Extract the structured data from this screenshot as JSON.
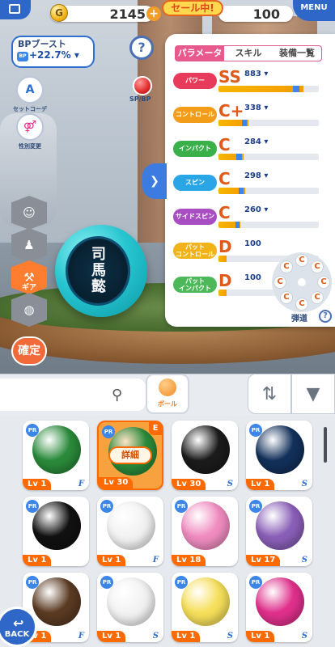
{
  "topbar": {
    "coins": "2145",
    "coin_glyph": "G",
    "plus": "+",
    "sale": "セール中!",
    "gems": "100",
    "menu_label": "MENU"
  },
  "boost": {
    "label": "BPブースト",
    "value": "+22.7% ▾",
    "chip": "BP"
  },
  "side": {
    "set_coordinate": "セットコーデ",
    "gender_change": "性別変更",
    "spbp": "SP/BP",
    "help": "?"
  },
  "vtabs": {
    "gear_label": "ギア"
  },
  "confirm_label": "確定",
  "panel": {
    "tabs": [
      "パラメータ",
      "スキル",
      "装備一覧"
    ],
    "active_tab": 0,
    "stats": [
      {
        "name": "パワー",
        "rank": "SS",
        "value": "883 ▾",
        "fill": 0.85,
        "blue_start": 0.74,
        "blue_width": 0.07,
        "color": "#e83a5a"
      },
      {
        "name": "コントロール",
        "rank": "C+",
        "value": "338 ▾",
        "fill": 0.3,
        "blue_start": 0.23,
        "blue_width": 0.05,
        "color": "#f29c1a"
      },
      {
        "name": "インパクト",
        "rank": "C",
        "value": "284 ▾",
        "fill": 0.25,
        "blue_start": 0.18,
        "blue_width": 0.05,
        "color": "#39b04a"
      },
      {
        "name": "スピン",
        "rank": "C",
        "value": "298 ▾",
        "fill": 0.27,
        "blue_start": 0.2,
        "blue_width": 0.05,
        "color": "#2aa6e6"
      },
      {
        "name": "サイドスピン",
        "rank": "C",
        "value": "260 ▾",
        "fill": 0.22,
        "blue_start": 0.17,
        "blue_width": 0.04,
        "color": "#a84ec2"
      },
      {
        "name": "パット\nコントロール",
        "rank": "D",
        "value": "100",
        "fill": 0.08,
        "blue_start": 0.05,
        "blue_width": 0.0,
        "color": "#f2b21a"
      },
      {
        "name": "パット\nインパクト",
        "rank": "D",
        "value": "100",
        "fill": 0.08,
        "blue_start": 0.05,
        "blue_width": 0.0,
        "color": "#4cb85a"
      }
    ],
    "spin_letters": [
      "C",
      "C",
      "C",
      "C",
      "C",
      "C",
      "C",
      "C"
    ],
    "trajectory_label": "弾道",
    "trajectory_help": "?"
  },
  "toolbar": {
    "ball_tab_label": "ボール",
    "sort_glyph": "⇅",
    "filter_glyph": "▼"
  },
  "grid": {
    "cards": [
      {
        "level": "Lv 1",
        "pr": "PR",
        "brand": "F",
        "color": "#2a8a3a",
        "selected": false
      },
      {
        "level": "Lv 30",
        "pr": "PR",
        "brand": "",
        "color": "#2a8a3a",
        "selected": true,
        "badge": "E",
        "detail": "詳細"
      },
      {
        "level": "Lv 30",
        "pr": "",
        "brand": "S",
        "color": "#1b1b1b",
        "selected": false
      },
      {
        "level": "Lv 1",
        "pr": "PR",
        "brand": "S",
        "color": "#12305a",
        "selected": false
      },
      {
        "level": "Lv 1",
        "pr": "PR",
        "brand": "",
        "color": "#111111",
        "selected": false
      },
      {
        "level": "Lv 1",
        "pr": "PR",
        "brand": "F",
        "color": "#f2f2f2",
        "selected": false
      },
      {
        "level": "Lv 18",
        "pr": "PR",
        "brand": "",
        "color": "#f08cc0",
        "selected": false
      },
      {
        "level": "Lv 17",
        "pr": "PR",
        "brand": "S",
        "color": "#8a5fb8",
        "selected": false
      },
      {
        "level": "Lv 1",
        "pr": "PR",
        "brand": "F",
        "color": "#5a3a22",
        "selected": false
      },
      {
        "level": "Lv 1",
        "pr": "PR",
        "brand": "S",
        "color": "#f2f2f2",
        "selected": false
      },
      {
        "level": "Lv 1",
        "pr": "PR",
        "brand": "S",
        "color": "#f6df5a",
        "selected": false
      },
      {
        "level": "Lv 1",
        "pr": "PR",
        "brand": "S",
        "color": "#e0308c",
        "selected": false
      }
    ]
  },
  "back_label": "BACK"
}
